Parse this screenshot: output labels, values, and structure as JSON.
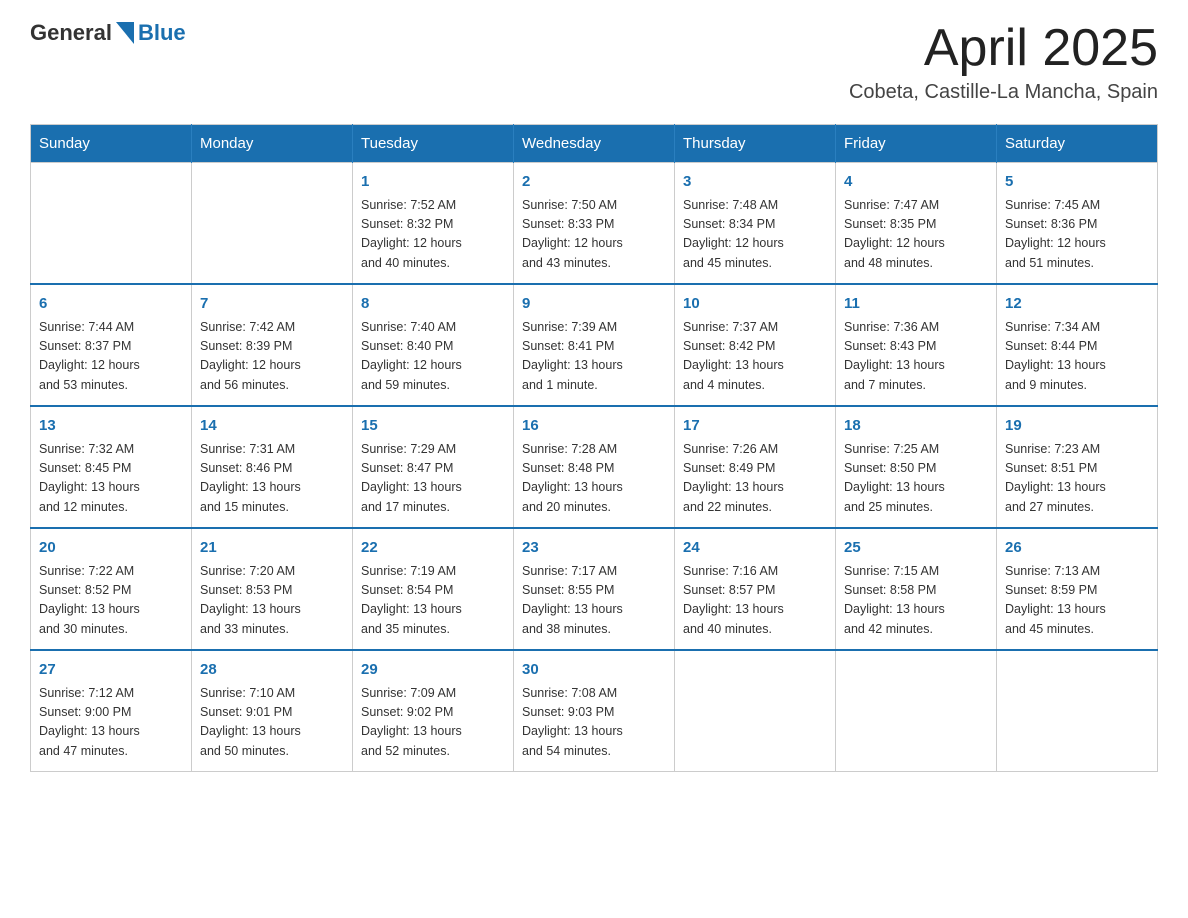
{
  "header": {
    "logo": {
      "general": "General",
      "blue": "Blue"
    },
    "title": "April 2025",
    "location": "Cobeta, Castille-La Mancha, Spain"
  },
  "days_of_week": [
    "Sunday",
    "Monday",
    "Tuesday",
    "Wednesday",
    "Thursday",
    "Friday",
    "Saturday"
  ],
  "weeks": [
    [
      {
        "day": "",
        "info": ""
      },
      {
        "day": "",
        "info": ""
      },
      {
        "day": "1",
        "info": "Sunrise: 7:52 AM\nSunset: 8:32 PM\nDaylight: 12 hours\nand 40 minutes."
      },
      {
        "day": "2",
        "info": "Sunrise: 7:50 AM\nSunset: 8:33 PM\nDaylight: 12 hours\nand 43 minutes."
      },
      {
        "day": "3",
        "info": "Sunrise: 7:48 AM\nSunset: 8:34 PM\nDaylight: 12 hours\nand 45 minutes."
      },
      {
        "day": "4",
        "info": "Sunrise: 7:47 AM\nSunset: 8:35 PM\nDaylight: 12 hours\nand 48 minutes."
      },
      {
        "day": "5",
        "info": "Sunrise: 7:45 AM\nSunset: 8:36 PM\nDaylight: 12 hours\nand 51 minutes."
      }
    ],
    [
      {
        "day": "6",
        "info": "Sunrise: 7:44 AM\nSunset: 8:37 PM\nDaylight: 12 hours\nand 53 minutes."
      },
      {
        "day": "7",
        "info": "Sunrise: 7:42 AM\nSunset: 8:39 PM\nDaylight: 12 hours\nand 56 minutes."
      },
      {
        "day": "8",
        "info": "Sunrise: 7:40 AM\nSunset: 8:40 PM\nDaylight: 12 hours\nand 59 minutes."
      },
      {
        "day": "9",
        "info": "Sunrise: 7:39 AM\nSunset: 8:41 PM\nDaylight: 13 hours\nand 1 minute."
      },
      {
        "day": "10",
        "info": "Sunrise: 7:37 AM\nSunset: 8:42 PM\nDaylight: 13 hours\nand 4 minutes."
      },
      {
        "day": "11",
        "info": "Sunrise: 7:36 AM\nSunset: 8:43 PM\nDaylight: 13 hours\nand 7 minutes."
      },
      {
        "day": "12",
        "info": "Sunrise: 7:34 AM\nSunset: 8:44 PM\nDaylight: 13 hours\nand 9 minutes."
      }
    ],
    [
      {
        "day": "13",
        "info": "Sunrise: 7:32 AM\nSunset: 8:45 PM\nDaylight: 13 hours\nand 12 minutes."
      },
      {
        "day": "14",
        "info": "Sunrise: 7:31 AM\nSunset: 8:46 PM\nDaylight: 13 hours\nand 15 minutes."
      },
      {
        "day": "15",
        "info": "Sunrise: 7:29 AM\nSunset: 8:47 PM\nDaylight: 13 hours\nand 17 minutes."
      },
      {
        "day": "16",
        "info": "Sunrise: 7:28 AM\nSunset: 8:48 PM\nDaylight: 13 hours\nand 20 minutes."
      },
      {
        "day": "17",
        "info": "Sunrise: 7:26 AM\nSunset: 8:49 PM\nDaylight: 13 hours\nand 22 minutes."
      },
      {
        "day": "18",
        "info": "Sunrise: 7:25 AM\nSunset: 8:50 PM\nDaylight: 13 hours\nand 25 minutes."
      },
      {
        "day": "19",
        "info": "Sunrise: 7:23 AM\nSunset: 8:51 PM\nDaylight: 13 hours\nand 27 minutes."
      }
    ],
    [
      {
        "day": "20",
        "info": "Sunrise: 7:22 AM\nSunset: 8:52 PM\nDaylight: 13 hours\nand 30 minutes."
      },
      {
        "day": "21",
        "info": "Sunrise: 7:20 AM\nSunset: 8:53 PM\nDaylight: 13 hours\nand 33 minutes."
      },
      {
        "day": "22",
        "info": "Sunrise: 7:19 AM\nSunset: 8:54 PM\nDaylight: 13 hours\nand 35 minutes."
      },
      {
        "day": "23",
        "info": "Sunrise: 7:17 AM\nSunset: 8:55 PM\nDaylight: 13 hours\nand 38 minutes."
      },
      {
        "day": "24",
        "info": "Sunrise: 7:16 AM\nSunset: 8:57 PM\nDaylight: 13 hours\nand 40 minutes."
      },
      {
        "day": "25",
        "info": "Sunrise: 7:15 AM\nSunset: 8:58 PM\nDaylight: 13 hours\nand 42 minutes."
      },
      {
        "day": "26",
        "info": "Sunrise: 7:13 AM\nSunset: 8:59 PM\nDaylight: 13 hours\nand 45 minutes."
      }
    ],
    [
      {
        "day": "27",
        "info": "Sunrise: 7:12 AM\nSunset: 9:00 PM\nDaylight: 13 hours\nand 47 minutes."
      },
      {
        "day": "28",
        "info": "Sunrise: 7:10 AM\nSunset: 9:01 PM\nDaylight: 13 hours\nand 50 minutes."
      },
      {
        "day": "29",
        "info": "Sunrise: 7:09 AM\nSunset: 9:02 PM\nDaylight: 13 hours\nand 52 minutes."
      },
      {
        "day": "30",
        "info": "Sunrise: 7:08 AM\nSunset: 9:03 PM\nDaylight: 13 hours\nand 54 minutes."
      },
      {
        "day": "",
        "info": ""
      },
      {
        "day": "",
        "info": ""
      },
      {
        "day": "",
        "info": ""
      }
    ]
  ]
}
